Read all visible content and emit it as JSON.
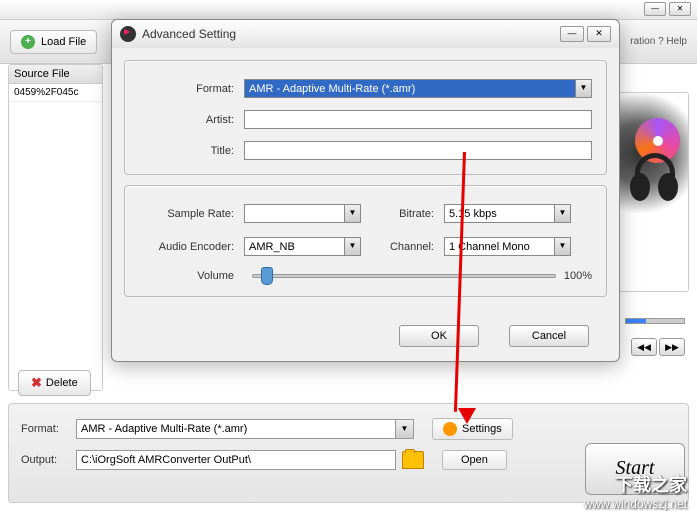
{
  "main": {
    "load_file": "Load File",
    "ration_link": "ration",
    "help_link": "Help",
    "source_file_header": "Source File",
    "file_row": "0459%2F045c",
    "delete": "Delete",
    "format_label": "Format:",
    "format_value": "AMR - Adaptive Multi-Rate (*.amr)",
    "output_label": "Output:",
    "output_value": "C:\\iOrgSoft AMRConverter OutPut\\",
    "settings": "Settings",
    "open": "Open",
    "start": "Start"
  },
  "dialog": {
    "title": "Advanced  Setting",
    "format_label": "Format:",
    "format_value": "AMR - Adaptive Multi-Rate (*.amr)",
    "artist_label": "Artist:",
    "artist_value": "",
    "title_label": "Title:",
    "title_value": "",
    "sample_rate_label": "Sample Rate:",
    "sample_rate_value": "",
    "bitrate_label": "Bitrate:",
    "bitrate_value": "5.15 kbps",
    "audio_encoder_label": "Audio Encoder:",
    "audio_encoder_value": "AMR_NB",
    "channel_label": "Channel:",
    "channel_value": "1 Channel Mono",
    "volume_label": "Volume",
    "volume_pct": "100%",
    "ok": "OK",
    "cancel": "Cancel"
  },
  "watermark": {
    "line1": "下载之家",
    "line2": "www.windowszj.net"
  }
}
